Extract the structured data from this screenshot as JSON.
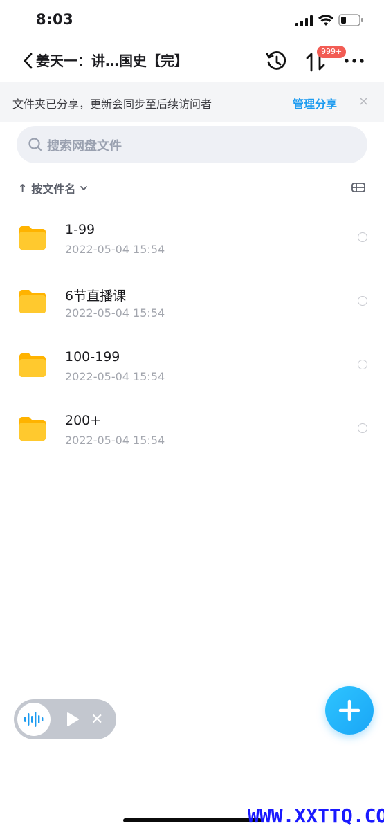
{
  "status_bar": {
    "time": "8:03"
  },
  "nav": {
    "title": "姜天一：讲…国史【完】",
    "transfer_badge": "999+"
  },
  "banner": {
    "text": "文件夹已分享，更新会同步至后续访问者",
    "manage_label": "管理分享",
    "close_glyph": "×"
  },
  "search": {
    "placeholder": "搜索网盘文件"
  },
  "sort": {
    "arrow": "↑",
    "label": "按文件名"
  },
  "files": [
    {
      "name": "1-99",
      "date": "2022-05-04 15:54"
    },
    {
      "name": "6节直播课",
      "date": "2022-05-04 15:54"
    },
    {
      "name": "100-199",
      "date": "2022-05-04 15:54"
    },
    {
      "name": "200+",
      "date": "2022-05-04 15:54"
    }
  ],
  "player": {
    "close_glyph": "✕"
  },
  "watermark": "WWW.XXTTQ.COM",
  "colors": {
    "accent": "#1c9bf0",
    "folder": "#ffc21a",
    "badge": "#f25c54"
  }
}
